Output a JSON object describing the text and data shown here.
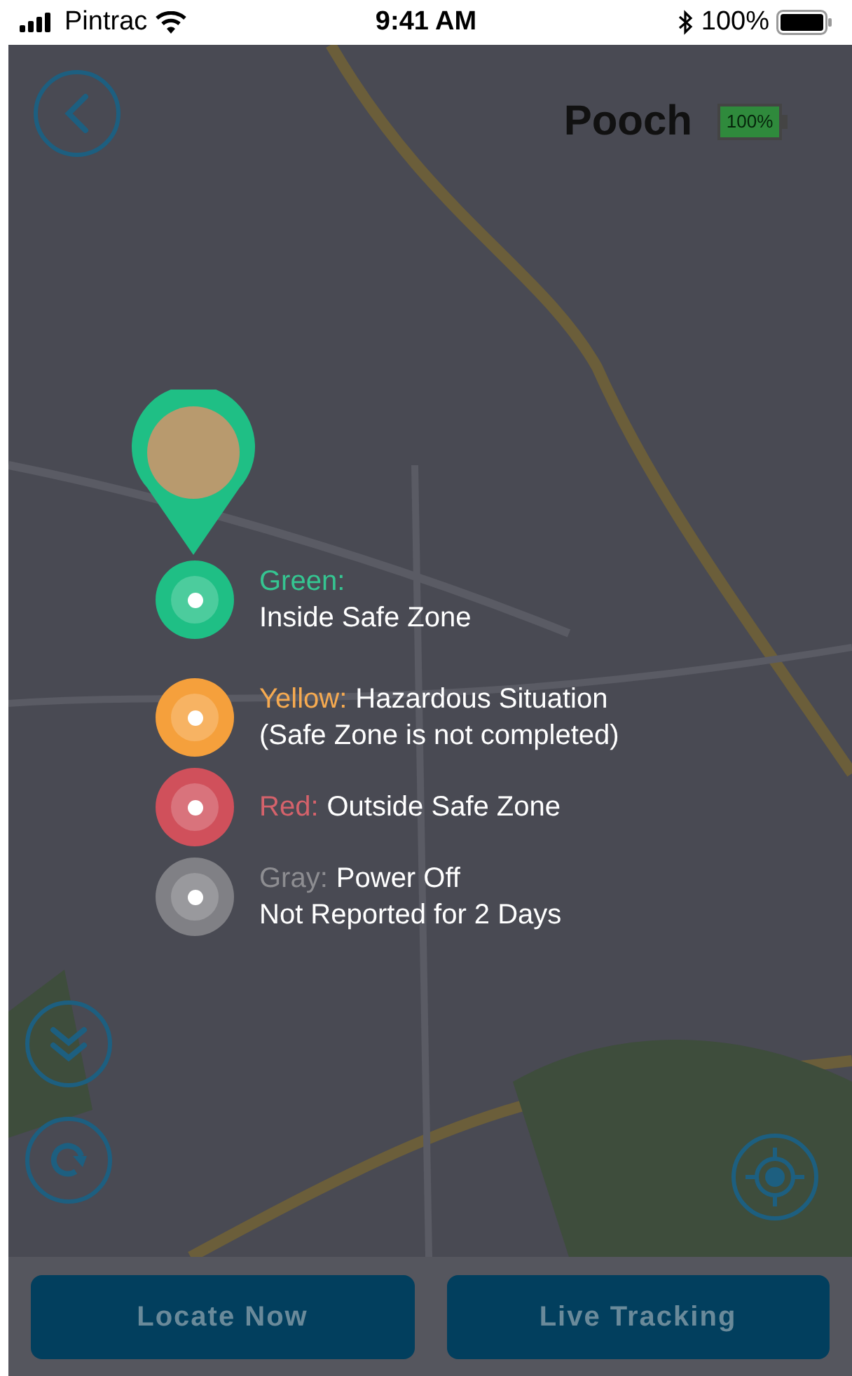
{
  "status_bar": {
    "carrier": "Pintrac",
    "time": "9:41 AM",
    "battery": "100%"
  },
  "header": {
    "pet_name": "Pooch",
    "battery": "100%",
    "battery_meter": {
      "level": 1
    }
  },
  "legend": [
    {
      "label": "Green:",
      "note": "Inside Safe Zone",
      "color": "#1fbf85"
    },
    {
      "label": "Yellow:",
      "text": "Hazardous Situation",
      "note": "(Safe Zone is not completed)",
      "color": "#f5a03c"
    },
    {
      "label": "Red:",
      "text": "Outside Safe Zone",
      "color": "#d0505b"
    },
    {
      "label": "Gray:",
      "text": "Power Off",
      "note": "Not Reported for 2 Days",
      "color": "#808085"
    }
  ],
  "buttons": [
    {
      "label": "Locate Now"
    },
    {
      "label": "Live Tracking"
    }
  ]
}
